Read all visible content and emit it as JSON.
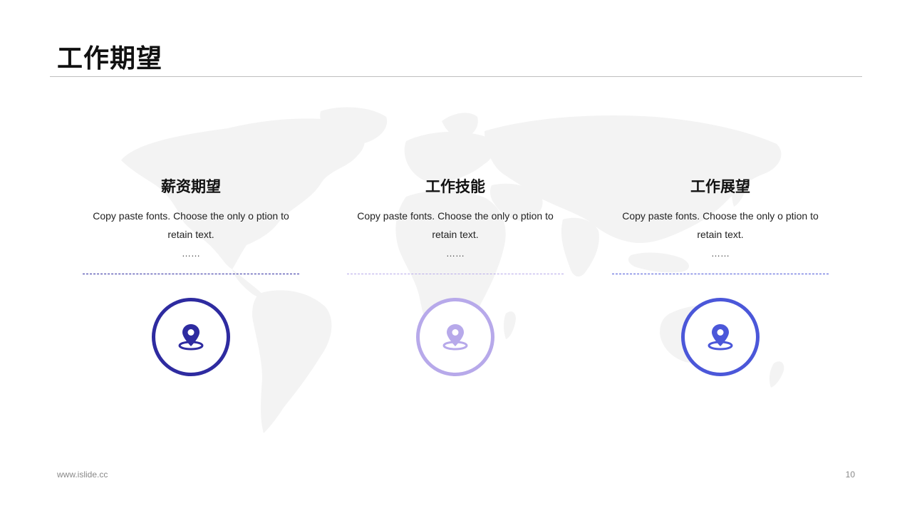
{
  "slide": {
    "title": "工作期望",
    "footer_url": "www.islide.cc",
    "page_number": "10"
  },
  "cards": [
    {
      "heading": "薪资期望",
      "body": "Copy paste fonts. Choose the only o ption to retain text.",
      "ellipsis": "……",
      "icon": "location-pin-icon",
      "color": "#2e2ba0"
    },
    {
      "heading": "工作技能",
      "body": "Copy paste fonts. Choose the only o ption to retain text.",
      "ellipsis": "……",
      "icon": "location-pin-icon",
      "color": "#b7a9ea"
    },
    {
      "heading": "工作展望",
      "body": "Copy paste fonts. Choose the only o ption to retain text.",
      "ellipsis": "……",
      "icon": "location-pin-icon",
      "color": "#4b57d9"
    }
  ],
  "colors": {
    "background": "#ffffff",
    "map": "#f2f2f2",
    "rule": "#bfbfbf",
    "text": "#111111",
    "footer": "#888888"
  }
}
